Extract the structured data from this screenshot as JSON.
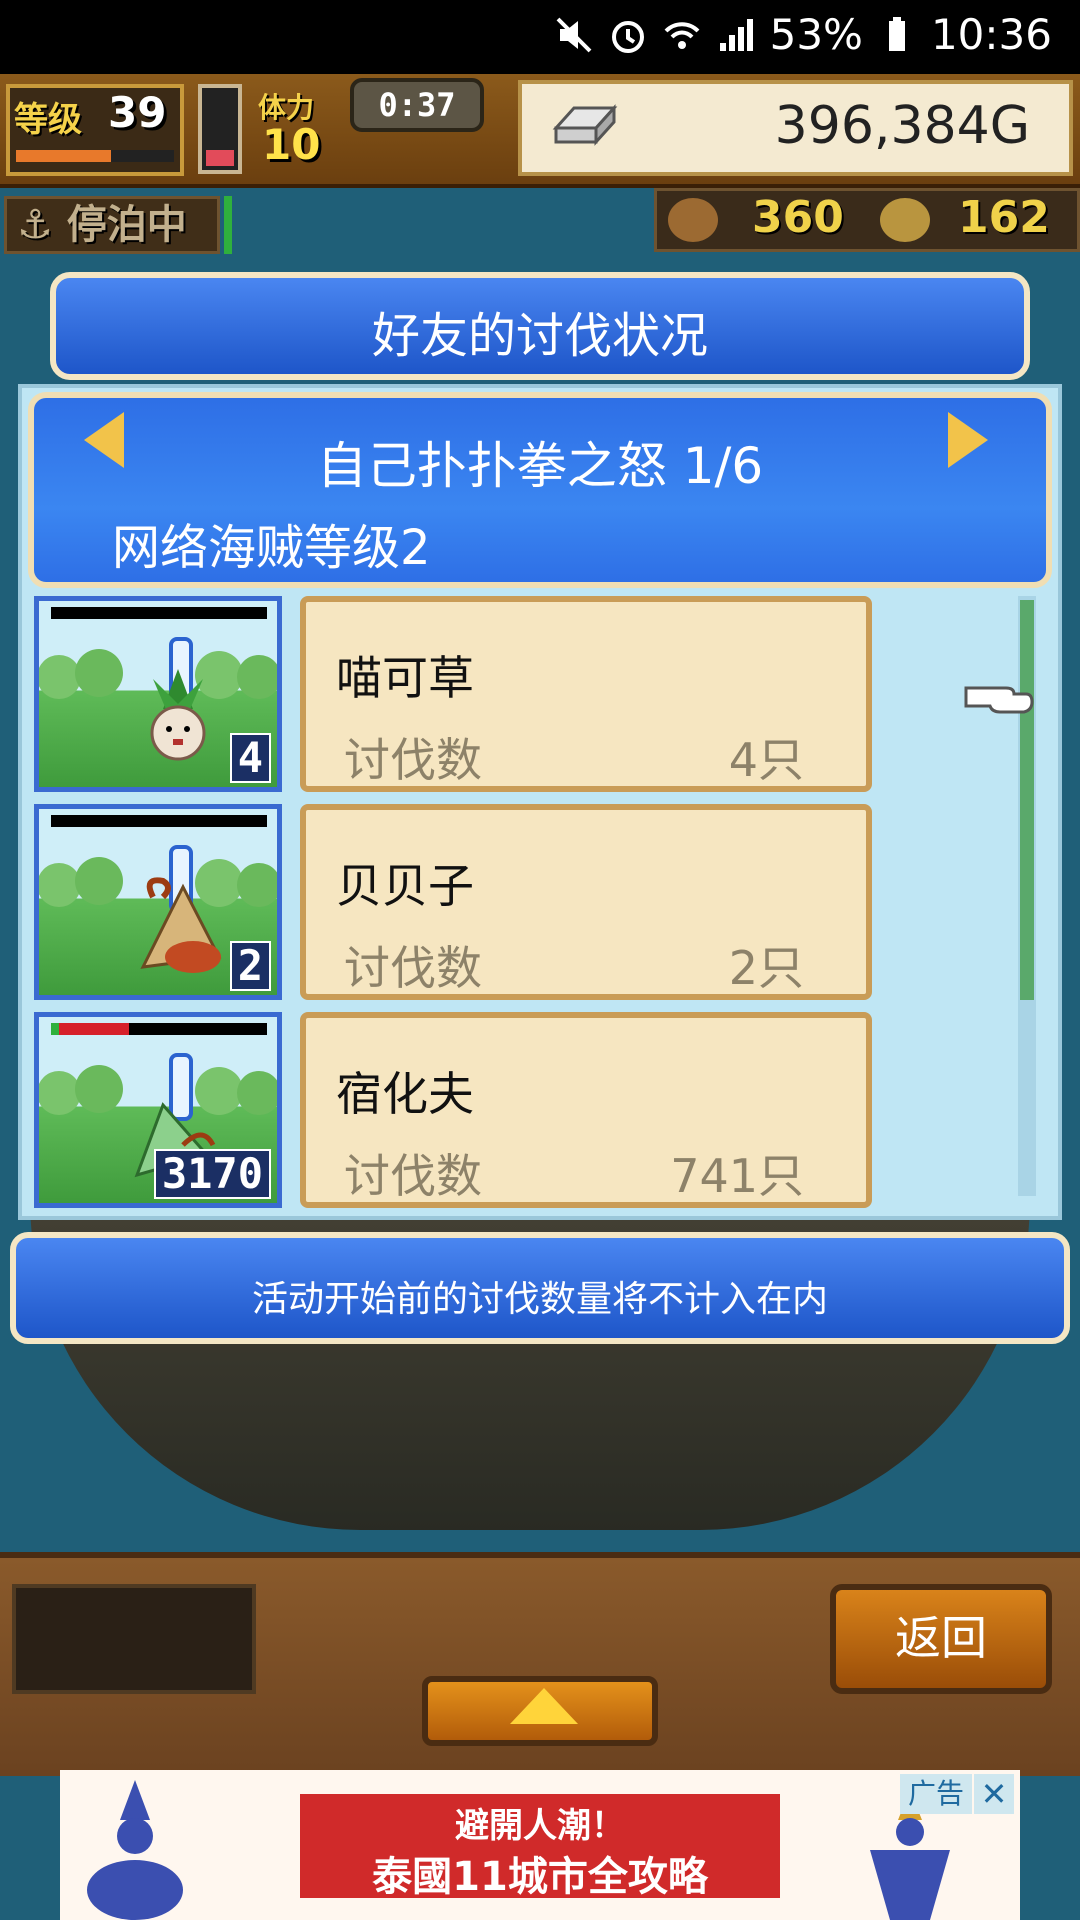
{
  "status_bar": {
    "battery": "53%",
    "time": "10:36",
    "icons": [
      "mute-icon",
      "alarm-icon",
      "wifi-icon",
      "signal-icon",
      "battery-icon"
    ]
  },
  "hud": {
    "level_label": "等级",
    "level_value": "39",
    "level_progress": 0.6,
    "stamina_label": "体力",
    "stamina_value": "10",
    "stamina_fill": 0.2,
    "timer": "0:37",
    "gold": "396,384G",
    "docked_label": "停泊中",
    "resource1": "360",
    "resource2": "162"
  },
  "panel": {
    "title": "好友的讨伐状况",
    "event_title": "自己扑扑拳之怒 1/6",
    "event_subtitle": "网络海贼等级2",
    "rows": [
      {
        "name": "喵可草",
        "label": "讨伐数",
        "value": "4只",
        "badge": "4",
        "hp": 1.0,
        "hp_color": "#000000"
      },
      {
        "name": "贝贝子",
        "label": "讨伐数",
        "value": "2只",
        "badge": "2",
        "hp": 1.0,
        "hp_color": "#000000"
      },
      {
        "name": "宿化夫",
        "label": "讨伐数",
        "value": "741只",
        "badge": "3170",
        "hp": 0.36,
        "hp_color": "#d6202a"
      }
    ],
    "notice": "活动开始前的讨伐数量将不计入在内"
  },
  "bottom": {
    "back_label": "返回"
  },
  "ad": {
    "line1": "避開人潮！",
    "line2": "泰國11城市全攻略",
    "tag": "广告",
    "close": "✕"
  },
  "colors": {
    "panel_blue": "#2e6fe6",
    "card_bg": "#f6e6c1",
    "wood": "#8a5a2b"
  }
}
